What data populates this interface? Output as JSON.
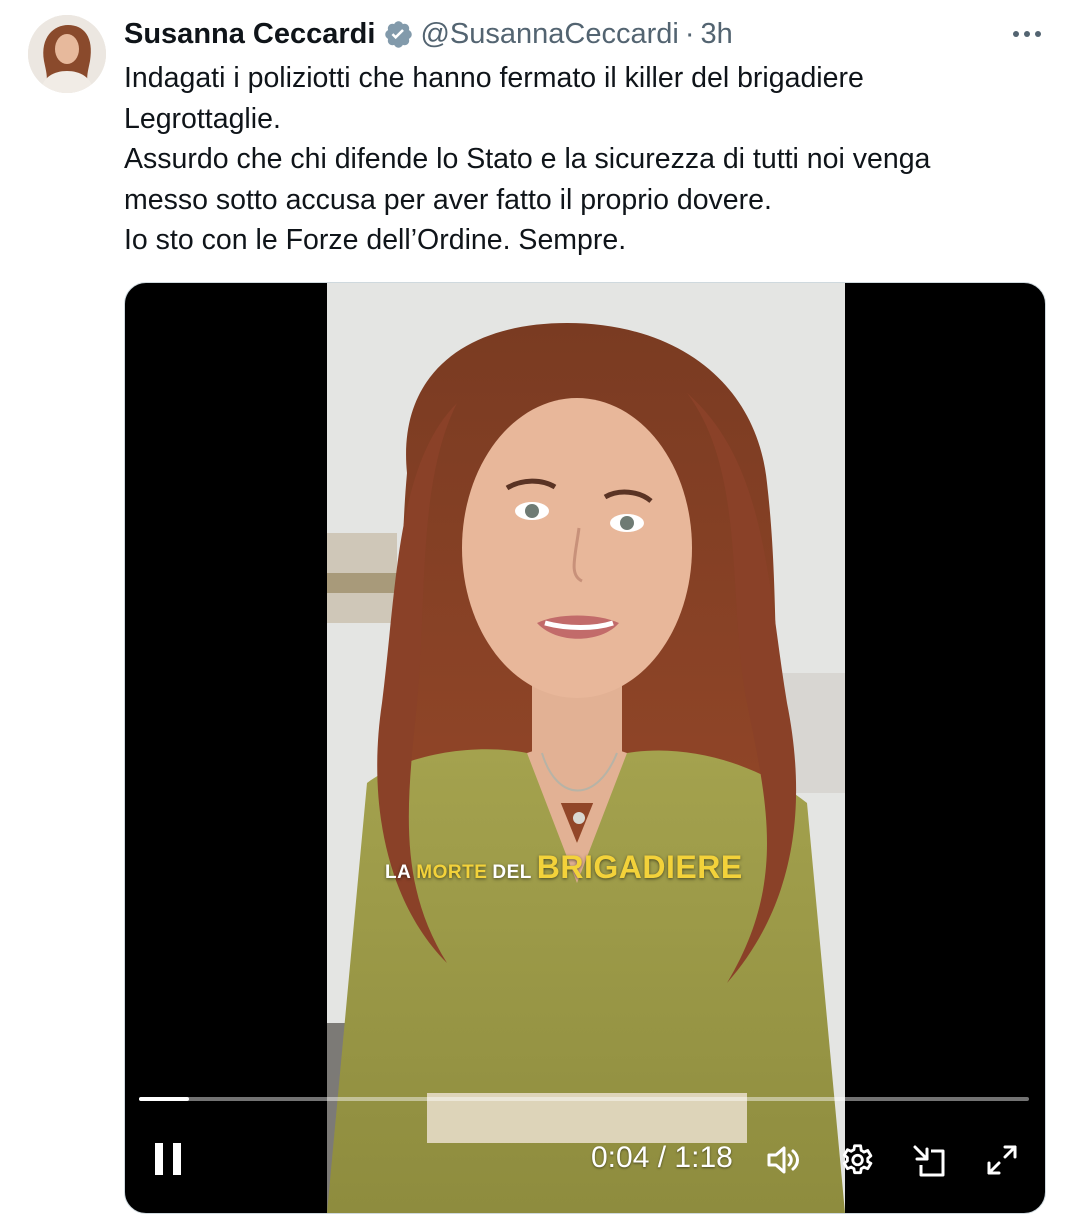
{
  "post": {
    "author_name": "Susanna Ceccardi",
    "handle": "@SusannaCeccardi",
    "separator": "·",
    "time_ago": "3h",
    "text_lines": [
      "Indagati i poliziotti che hanno fermato il killer del brigadiere",
      "Legrottaglie.",
      "Assurdo che chi difende lo Stato e la sicurezza di tutti noi venga",
      "messo sotto accusa per aver fatto il proprio dovere.",
      "Io sto con le Forze dell’Ordine. Sempre."
    ]
  },
  "video": {
    "caption_part1": "LA",
    "caption_part2": "MORTE",
    "caption_part3": "DEL",
    "caption_part4": "BRIGADIERE",
    "current_time": "0:04",
    "time_sep": "/",
    "duration": "1:18",
    "progress_fraction": 0.056
  },
  "icons": {
    "verified": "verified-badge-icon",
    "more": "more-options-icon",
    "pause": "pause-icon",
    "volume": "volume-icon",
    "settings": "gear-icon",
    "pip": "picture-in-picture-icon",
    "fullscreen": "fullscreen-icon"
  },
  "colors": {
    "text_primary": "#0f1419",
    "text_secondary": "#536471",
    "verified": "#829aab",
    "caption_accent": "#f3d23a"
  }
}
